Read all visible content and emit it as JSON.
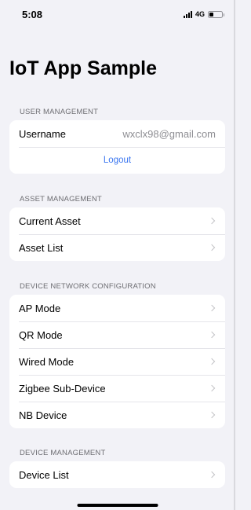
{
  "status_bar": {
    "time": "5:08",
    "network": "4G",
    "signal_icon": "cellular-signal-icon",
    "battery_icon": "battery-icon",
    "battery_level": 0.35
  },
  "page": {
    "title": "IoT App Sample"
  },
  "user_management": {
    "header": "USER MANAGEMENT",
    "username_label": "Username",
    "username_value": "wxclx98@gmail.com",
    "logout_label": "Logout"
  },
  "asset_management": {
    "header": "ASSET MANAGEMENT",
    "items": [
      {
        "label": "Current Asset"
      },
      {
        "label": "Asset List"
      }
    ]
  },
  "device_network": {
    "header": "DEVICE NETWORK CONFIGURATION",
    "items": [
      {
        "label": "AP Mode"
      },
      {
        "label": "QR Mode"
      },
      {
        "label": "Wired Mode"
      },
      {
        "label": "Zigbee Sub-Device"
      },
      {
        "label": "NB Device"
      }
    ]
  },
  "device_management": {
    "header": "DEVICE MANAGEMENT",
    "items": [
      {
        "label": "Device List"
      }
    ]
  },
  "colors": {
    "background": "#f2f2f7",
    "link": "#3a76f0",
    "secondary_text": "#8e8e93"
  }
}
